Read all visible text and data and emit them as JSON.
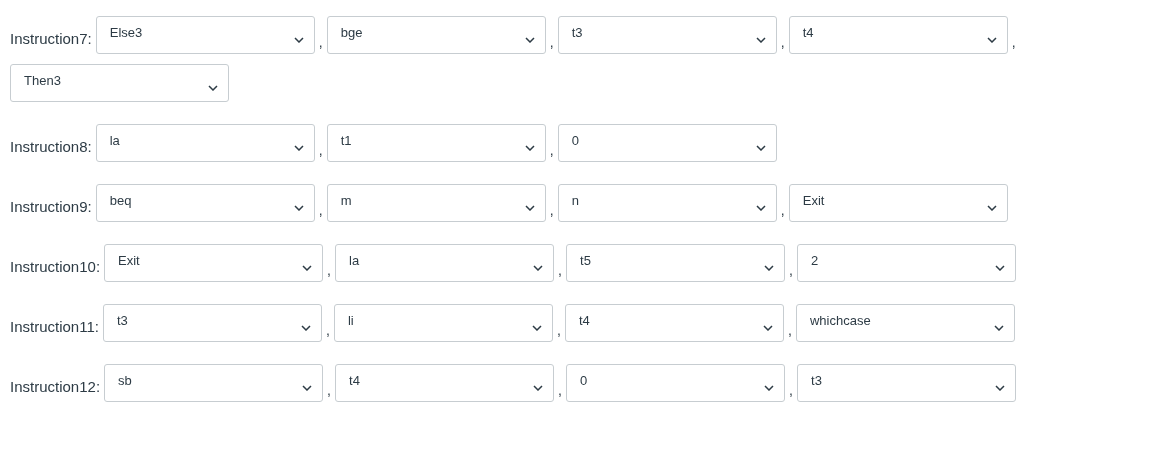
{
  "instructions": [
    {
      "label": "Instruction7:",
      "operands": [
        {
          "value": "Else3",
          "separator": ","
        },
        {
          "value": "bge",
          "separator": ","
        },
        {
          "value": "t3",
          "separator": ","
        },
        {
          "value": "t4",
          "separator": ","
        },
        {
          "value": "Then3"
        }
      ]
    },
    {
      "label": "Instruction8:",
      "operands": [
        {
          "value": "la",
          "separator": ","
        },
        {
          "value": "t1",
          "separator": ","
        },
        {
          "value": "0"
        }
      ]
    },
    {
      "label": "Instruction9:",
      "operands": [
        {
          "value": "beq",
          "separator": ","
        },
        {
          "value": "m",
          "separator": ","
        },
        {
          "value": "n",
          "separator": ","
        },
        {
          "value": "Exit"
        }
      ]
    },
    {
      "label": "Instruction10:",
      "operands": [
        {
          "value": "Exit",
          "separator": ","
        },
        {
          "value": "la",
          "separator": ","
        },
        {
          "value": "t5",
          "separator": ","
        },
        {
          "value": "2"
        }
      ]
    },
    {
      "label": "Instruction11:",
      "operands": [
        {
          "value": "t3",
          "separator": ","
        },
        {
          "value": "li",
          "separator": ","
        },
        {
          "value": "t4",
          "separator": ","
        },
        {
          "value": "whichcase"
        }
      ]
    },
    {
      "label": "Instruction12:",
      "operands": [
        {
          "value": "sb",
          "separator": ","
        },
        {
          "value": "t4",
          "separator": ","
        },
        {
          "value": "0",
          "separator": ","
        },
        {
          "value": "t3"
        }
      ]
    }
  ]
}
